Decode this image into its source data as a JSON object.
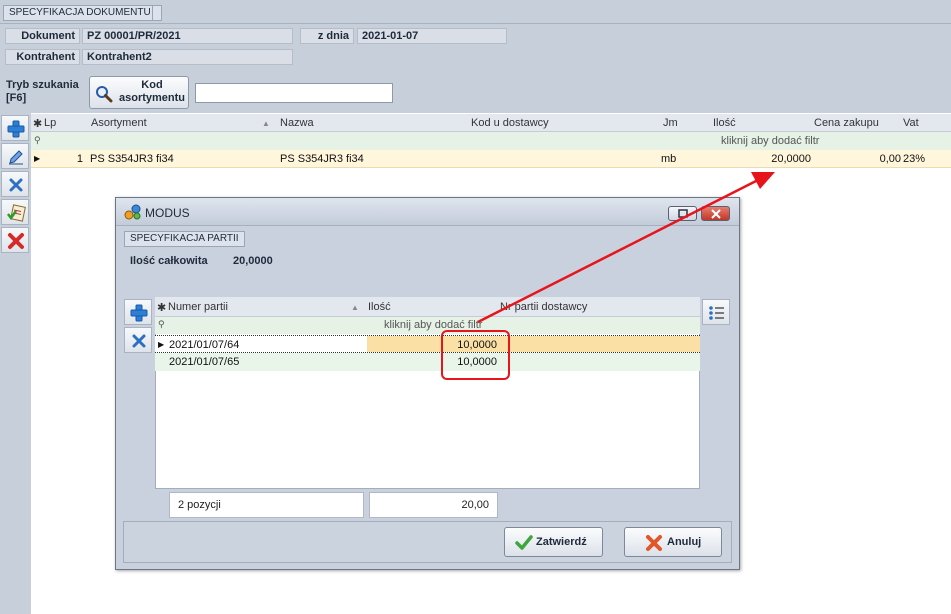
{
  "main": {
    "section_tab": "SPECYFIKACJA DOKUMENTU",
    "document_label": "Dokument",
    "document_value": "PZ 00001/PR/2021",
    "date_label": "z dnia",
    "date_value": "2021-01-07",
    "contractor_label": "Kontrahent",
    "contractor_value": "Kontrahent2",
    "search_mode_label": "Tryb szukania",
    "search_mode_key": "[F6]",
    "search_button_line1": "Kod",
    "search_button_line2": "asortymentu",
    "search_input_value": ""
  },
  "grid": {
    "columns": [
      "Lp",
      "Asortyment",
      "Nazwa",
      "Kod u dostawcy",
      "Jm",
      "Ilość",
      "Cena zakupu",
      "Vat"
    ],
    "filter_hint": "kliknij aby dodać filtr",
    "rows": [
      {
        "lp": "1",
        "asortyment": "PS S354JR3 fi34",
        "nazwa": "PS S354JR3 fi34",
        "kod_u_dostawcy": "",
        "jm": "mb",
        "ilosc": "20,0000",
        "cena_zakupu": "0,00",
        "vat": "23%"
      }
    ]
  },
  "dialog": {
    "title": "MODUS",
    "section_tab": "SPECYFIKACJA PARTII",
    "total_label": "Ilość całkowita",
    "total_value": "20,0000",
    "columns": [
      "Numer partii",
      "Ilość",
      "Nr partii dostawcy"
    ],
    "filter_hint": "kliknij aby dodać filtr",
    "rows": [
      {
        "numer_partii": "2021/01/07/64",
        "ilosc": "10,0000",
        "nr_partii_dostawcy": ""
      },
      {
        "numer_partii": "2021/01/07/65",
        "ilosc": "10,0000",
        "nr_partii_dostawcy": ""
      }
    ],
    "footer_count": "2 pozycji",
    "footer_sum": "20,00",
    "confirm_label": "Zatwierdź",
    "cancel_label": "Anuluj"
  },
  "colors": {
    "annotation_red": "#e8141b",
    "selected_row": "#fff6db",
    "filter_row": "#e6f2e6",
    "window_bg": "#c7cfdb"
  }
}
